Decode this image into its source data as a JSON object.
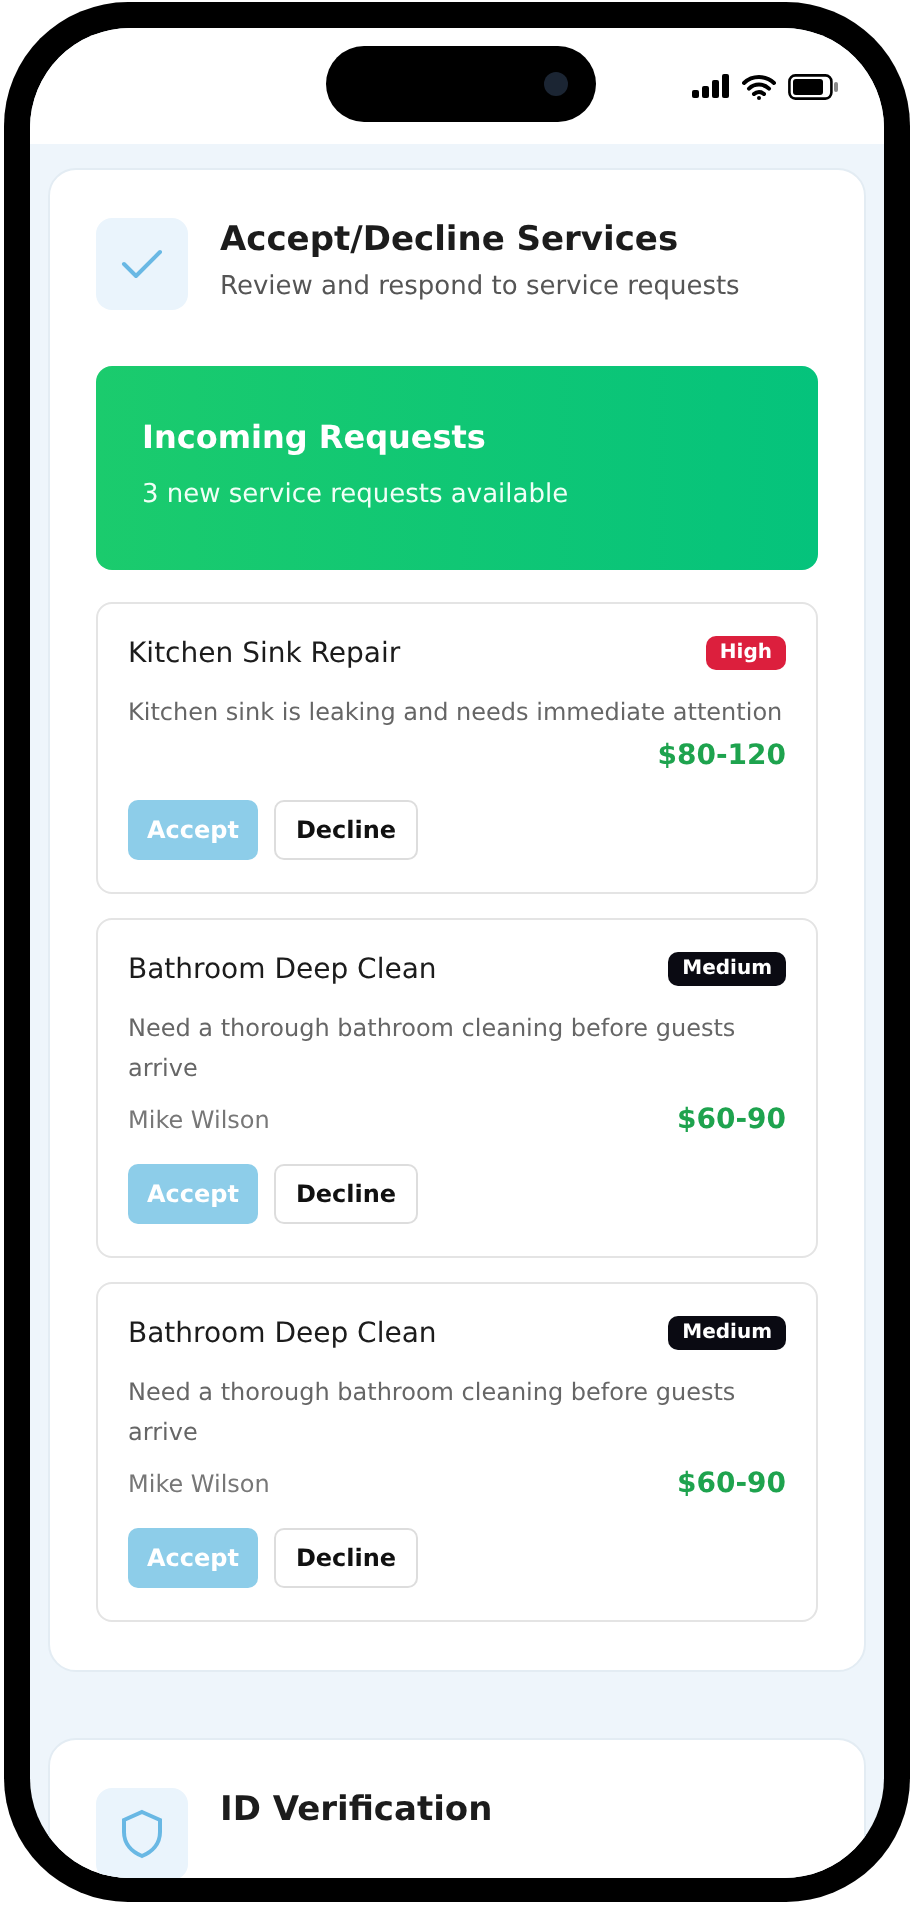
{
  "section": {
    "title": "Accept/Decline Services",
    "subtitle": "Review and respond to service requests"
  },
  "banner": {
    "title": "Incoming Requests",
    "subtitle": "3 new service requests available"
  },
  "requests": [
    {
      "title": "Kitchen Sink Repair",
      "priority": "High",
      "color": "#dc1f3d",
      "description": "Kitchen sink is leaking and needs immediate attention",
      "price": "$80-120",
      "accept": "Accept",
      "decline": "Decline"
    },
    {
      "title": "Bathroom Deep Clean",
      "priority": "Medium",
      "color": "#0a0a12",
      "description": "Need a thorough bathroom cleaning before guests arrive",
      "customer": "Mike Wilson",
      "price": "$60-90",
      "accept": "Accept",
      "decline": "Decline"
    },
    {
      "title": "Bathroom Deep Clean",
      "priority": "Medium",
      "color": "#0a0a12",
      "description": "Need a thorough bathroom cleaning before guests arrive",
      "customer": "Mike Wilson",
      "price": "$60-90",
      "accept": "Accept",
      "decline": "Decline"
    }
  ],
  "next_section": {
    "title": "ID Verification"
  }
}
